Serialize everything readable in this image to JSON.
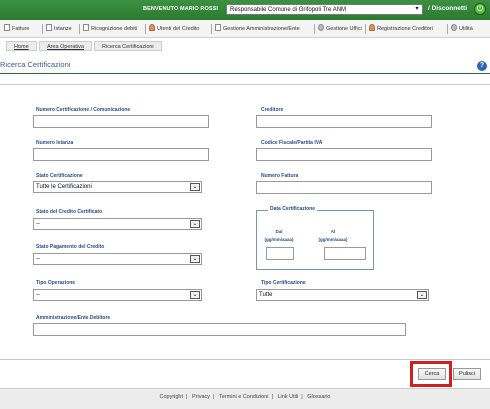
{
  "header": {
    "welcome": "BENVENUTO MARIO ROSSI",
    "entity_select": "Responsabile Comune di Grifopoli Tre ANM",
    "logout": "/ Disconnetti"
  },
  "menu": {
    "items": [
      {
        "label": "Fatture"
      },
      {
        "label": "Istanze"
      },
      {
        "label": "Ricognizione debiti"
      },
      {
        "label": "Utenti del Credito"
      },
      {
        "label": "Gestione Amministrazione/Ente"
      },
      {
        "label": "Gestione Uffici"
      },
      {
        "label": "Registrazione Creditori"
      },
      {
        "label": "Utilità"
      }
    ]
  },
  "breadcrumb": {
    "home": "Home",
    "area": "Area Operativa",
    "current": "Ricerca Certificazioni"
  },
  "page": {
    "title": "Ricerca Certificazioni"
  },
  "form": {
    "numero_cert_label": "Numero Certificazione / Comunicazione",
    "creditore_label": "Creditore",
    "numero_istanza_label": "Numero Istanza",
    "codice_fiscale_label": "Codice Fiscale/Partita IVA",
    "stato_cert_label": "Stato Certificazione",
    "stato_cert_value": "Tutte le Certificazioni",
    "numero_fattura_label": "Numero Fattura",
    "stato_credito_label": "Stato del Credito Certificato",
    "stato_credito_value": "--",
    "data_cert_legend": "Data Certificazione",
    "dal_label": "Dal",
    "al_label": "Al",
    "date_format": "(gg/mm/aaaa)",
    "stato_pagamento_label": "Stato Pagamento del Credito",
    "stato_pagamento_value": "--",
    "tipo_operazione_label": "Tipo Operazione",
    "tipo_operazione_value": "--",
    "tipo_cert_label": "Tipo Certificazione",
    "tipo_cert_value": "Tutte",
    "amministrazione_label": "Amministrazione/Ente Debitore"
  },
  "actions": {
    "cerca": "Cerca",
    "pulisci": "Pulisci"
  },
  "footer": {
    "links": [
      "Copyright",
      "Privacy",
      "Termini e Condizioni",
      "Link Utili",
      "Glossario"
    ]
  },
  "colors": {
    "topbar": "#2b7a30",
    "label": "#2a4d86",
    "highlight": "#d12020"
  }
}
